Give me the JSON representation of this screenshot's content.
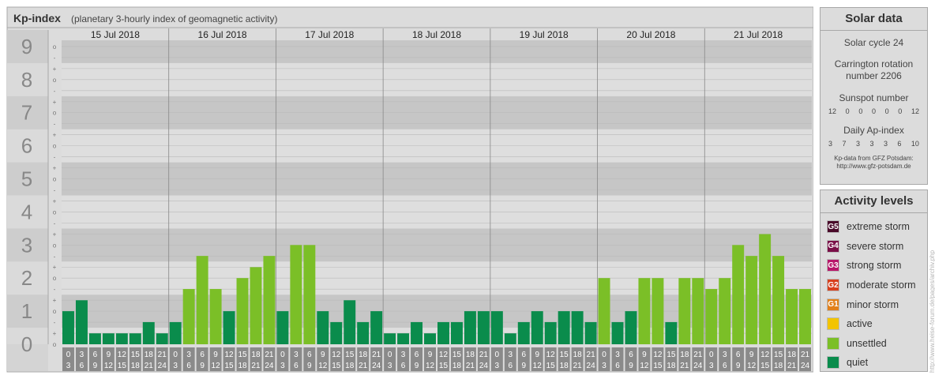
{
  "chart_data": {
    "type": "bar",
    "title": "Kp-index",
    "subtitle": "(planetary 3-hourly index of geomagnetic activity)",
    "days": [
      "15 Jul 2018",
      "16 Jul 2018",
      "17 Jul 2018",
      "18 Jul 2018",
      "19 Jul 2018",
      "20 Jul 2018",
      "21 Jul 2018"
    ],
    "interval_labels": [
      [
        "0",
        "3"
      ],
      [
        "3",
        "6"
      ],
      [
        "6",
        "9"
      ],
      [
        "9",
        "12"
      ],
      [
        "12",
        "15"
      ],
      [
        "15",
        "18"
      ],
      [
        "18",
        "21"
      ],
      [
        "21",
        "24"
      ]
    ],
    "y_ticks": [
      "0",
      "1",
      "2",
      "3",
      "4",
      "5",
      "6",
      "7",
      "8",
      "9"
    ],
    "sub_ticks": [
      "o",
      "+",
      "-",
      "o",
      "+",
      "-",
      "o",
      "+",
      "-",
      "o",
      "+",
      "-",
      "o",
      "+",
      "-",
      "o",
      "+",
      "-",
      "o",
      "+",
      "-",
      "o",
      "+",
      "-",
      "o",
      "+",
      "-",
      "o"
    ],
    "ylim": [
      0,
      9
    ],
    "values": [
      [
        1.0,
        1.33,
        0.33,
        0.33,
        0.33,
        0.33,
        0.67,
        0.33
      ],
      [
        0.67,
        1.67,
        2.67,
        1.67,
        1.0,
        2.0,
        2.33,
        2.67
      ],
      [
        1.0,
        3.0,
        3.0,
        1.0,
        0.67,
        1.33,
        0.67,
        1.0
      ],
      [
        0.33,
        0.33,
        0.67,
        0.33,
        0.67,
        0.67,
        1.0,
        1.0
      ],
      [
        1.0,
        0.33,
        0.67,
        1.0,
        0.67,
        1.0,
        1.0,
        0.67
      ],
      [
        2.0,
        0.67,
        1.0,
        2.0,
        2.0,
        0.67,
        2.0,
        2.0
      ],
      [
        1.67,
        2.0,
        3.0,
        2.67,
        3.33,
        2.67,
        1.67,
        1.67
      ]
    ],
    "colors": {
      "quiet": "#0a8c4c",
      "unsettled": "#7bbf27"
    }
  },
  "solar": {
    "title": "Solar data",
    "cycle": "Solar cycle 24",
    "carrington_1": "Carrington rotation",
    "carrington_2": "number 2206",
    "sunspot_label": "Sunspot number",
    "sunspot_values": [
      "12",
      "0",
      "0",
      "0",
      "0",
      "0",
      "12"
    ],
    "ap_label": "Daily Ap-index",
    "ap_values": [
      "3",
      "7",
      "3",
      "3",
      "3",
      "6",
      "10"
    ],
    "note_1": "Kp-data from GFZ Potsdam:",
    "note_2": "http://www.gfz-potsdam.de"
  },
  "activity": {
    "title": "Activity levels",
    "levels": [
      {
        "code": "G5",
        "label": "extreme storm",
        "color": "#4a0a2a"
      },
      {
        "code": "G4",
        "label": "severe storm",
        "color": "#7a0f48"
      },
      {
        "code": "G3",
        "label": "strong storm",
        "color": "#b8166a"
      },
      {
        "code": "G2",
        "label": "moderate storm",
        "color": "#d8401e"
      },
      {
        "code": "G1",
        "label": "minor storm",
        "color": "#e2801a"
      },
      {
        "code": "",
        "label": "active",
        "color": "#f2c400"
      },
      {
        "code": "",
        "label": "unsettled",
        "color": "#7bbf27"
      },
      {
        "code": "",
        "label": "quiet",
        "color": "#0a8c4c"
      }
    ]
  },
  "credit": "http://www.heise-forum.de/pages/archiv.php"
}
